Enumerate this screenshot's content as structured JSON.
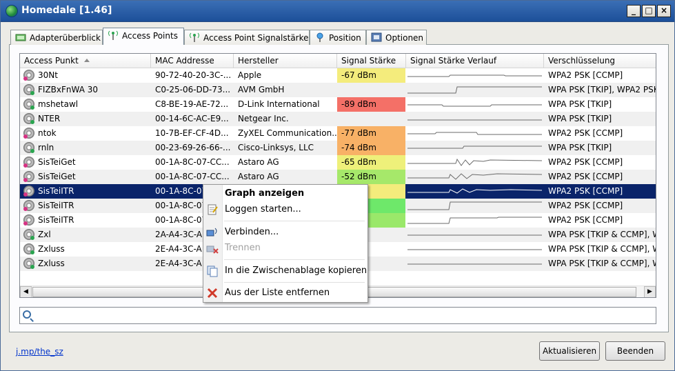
{
  "window": {
    "title": "Homedale [1.46]",
    "min_glyph": "_",
    "max_glyph": "□",
    "close_glyph": "×"
  },
  "tabs": [
    {
      "label": "Adapterüberblick",
      "icon": "network-adapter-icon"
    },
    {
      "label": "Access Points",
      "icon": "antenna-icon",
      "active": true
    },
    {
      "label": "Access Point Signalstärke",
      "icon": "antenna-icon"
    },
    {
      "label": "Position",
      "icon": "location-pin-icon"
    },
    {
      "label": "Optionen",
      "icon": "settings-icon"
    }
  ],
  "table": {
    "columns": [
      "Access Punkt",
      "MAC Addresse",
      "Hersteller",
      "Signal Stärke",
      "Signal Stärke Verlauf",
      "Verschlüsselung"
    ],
    "rows": [
      {
        "ap": "30Nt",
        "mac": "90-72-40-20-3C-...",
        "vendor": "Apple",
        "signal": "-67 dBm",
        "signal_value": -67,
        "color": "#f4ec7c",
        "enc": "WPA2 PSK [CCMP]"
      },
      {
        "ap": "FIZBxFnWA 30",
        "mac": "C0-25-06-DD-73...",
        "vendor": "AVM GmbH",
        "signal": "",
        "signal_value": null,
        "color": "",
        "enc": "WPA PSK [TKIP], WPA2 PSK"
      },
      {
        "ap": "mshetawl",
        "mac": "C8-BE-19-AE-72...",
        "vendor": "D-Link International",
        "signal": "-89 dBm",
        "signal_value": -89,
        "color": "#f47067",
        "enc": "WPA PSK [TKIP]"
      },
      {
        "ap": "NTER",
        "mac": "00-14-6C-AC-E9...",
        "vendor": "Netgear Inc.",
        "signal": "",
        "signal_value": null,
        "color": "",
        "enc": "WPA PSK [TKIP]"
      },
      {
        "ap": "ntok",
        "mac": "10-7B-EF-CF-4D...",
        "vendor": "ZyXEL Communication...",
        "signal": "-77 dBm",
        "signal_value": -77,
        "color": "#f8b166",
        "enc": "WPA2 PSK [CCMP]"
      },
      {
        "ap": "rnln",
        "mac": "00-23-69-26-66-...",
        "vendor": "Cisco-Linksys, LLC",
        "signal": "-74 dBm",
        "signal_value": -74,
        "color": "#f8b166",
        "enc": "WPA PSK [TKIP]"
      },
      {
        "ap": "SisTeiGet",
        "mac": "00-1A-8C-07-CC...",
        "vendor": "Astaro AG",
        "signal": "-65 dBm",
        "signal_value": -65,
        "color": "#eef07a",
        "enc": "WPA2 PSK [CCMP]"
      },
      {
        "ap": "SisTeiGet",
        "mac": "00-1A-8C-07-CC...",
        "vendor": "Astaro AG",
        "signal": "-52 dBm",
        "signal_value": -52,
        "color": "#a6e86a",
        "enc": "WPA2 PSK [CCMP]"
      },
      {
        "ap": "SisTeiITR",
        "mac": "00-1A-8C-07",
        "vendor": "",
        "signal": "",
        "signal_value": null,
        "color": "#f4ec7c",
        "enc": "WPA2 PSK [CCMP]",
        "selected": true
      },
      {
        "ap": "SisTeiITR",
        "mac": "00-1A-8C-07",
        "vendor": "",
        "signal": "",
        "signal_value": null,
        "color": "#6ee86a",
        "enc": "WPA2 PSK [CCMP]"
      },
      {
        "ap": "SisTeiITR",
        "mac": "00-1A-8C-07",
        "vendor": "",
        "signal": "",
        "signal_value": null,
        "color": "#9ae86a",
        "enc": "WPA2 PSK [CCMP]"
      },
      {
        "ap": "Zxl",
        "mac": "2A-A4-3C-A",
        "vendor": "",
        "signal": "",
        "signal_value": null,
        "color": "",
        "enc": "WPA PSK [TKIP & CCMP], W"
      },
      {
        "ap": "Zxluss",
        "mac": "2E-A4-3C-A",
        "vendor": "",
        "signal": "",
        "signal_value": null,
        "color": "",
        "enc": "WPA PSK [TKIP & CCMP], W"
      },
      {
        "ap": "Zxluss",
        "mac": "2E-A4-3C-A",
        "vendor": "",
        "signal": "",
        "signal_value": null,
        "color": "",
        "enc": "WPA PSK [TKIP & CCMP], W"
      }
    ]
  },
  "context_menu": {
    "items": [
      {
        "label": "Graph anzeigen",
        "bold": true,
        "icon": ""
      },
      {
        "label": "Loggen starten...",
        "icon": "log-icon"
      },
      {
        "label": "Verbinden...",
        "icon": "connect-icon"
      },
      {
        "label": "Trennen",
        "icon": "disconnect-icon",
        "disabled": true
      },
      {
        "label": "In die Zwischenablage kopieren",
        "icon": "copy-icon"
      },
      {
        "label": "Aus der Liste entfernen",
        "icon": "remove-icon"
      }
    ]
  },
  "search": {
    "value": "",
    "placeholder": ""
  },
  "footer": {
    "link": "j.mp/the_sz",
    "refresh_label": "Aktualisieren",
    "exit_label": "Beenden"
  }
}
